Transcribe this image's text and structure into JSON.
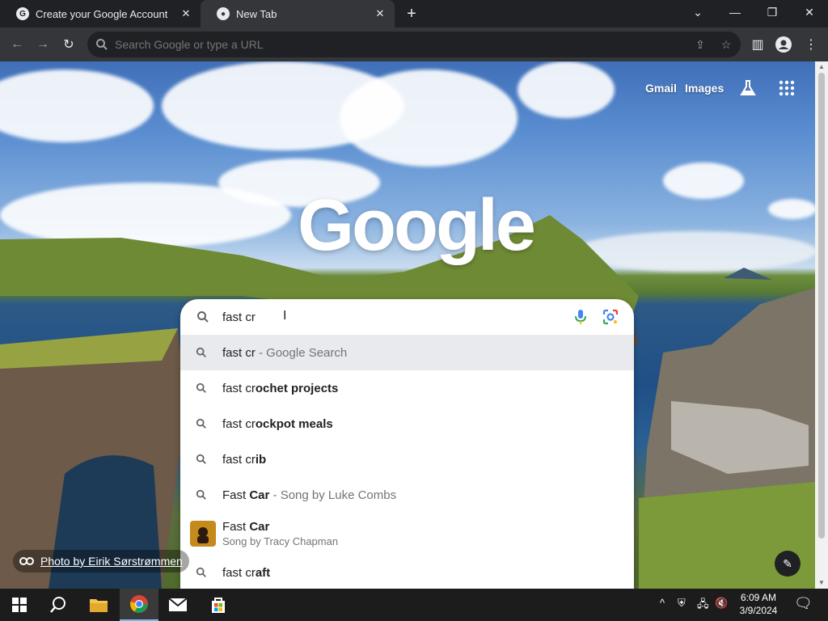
{
  "tabs": [
    {
      "title": "Create your Google Account",
      "favicon": "google-g-icon",
      "active": false
    },
    {
      "title": "New Tab",
      "favicon": "chrome-icon",
      "active": true
    }
  ],
  "omnibox": {
    "placeholder": "Search Google or type a URL",
    "value": ""
  },
  "toplinks": {
    "gmail": "Gmail",
    "images": "Images"
  },
  "logo": "Google",
  "search": {
    "value": "fast cr"
  },
  "suggestions": [
    {
      "pre": "fast cr",
      "bold": "",
      "tail": " - Google Search",
      "highlighted": true
    },
    {
      "pre": "fast cr",
      "bold": "ochet projects",
      "tail": ""
    },
    {
      "pre": "fast cr",
      "bold": "ockpot meals",
      "tail": ""
    },
    {
      "pre": "fast cr",
      "bold": "ib",
      "tail": ""
    },
    {
      "pre": "Fast ",
      "bold": "Car",
      "tail": " - Song by Luke Combs"
    },
    {
      "pre": "Fast ",
      "bold": "Car",
      "sub": "Song by Tracy Chapman",
      "image": true
    },
    {
      "pre": "fast cr",
      "bold": "aft",
      "tail": ""
    }
  ],
  "photo_credit": "Photo by Eirik Sørstrømmen",
  "clock": {
    "time": "6:09 AM",
    "date": "3/9/2024"
  },
  "colors": {
    "chrome_dark": "#202124",
    "toolbar": "#35363a",
    "highlight": "#e8eaed",
    "taskbar": "#1c1c1c"
  }
}
